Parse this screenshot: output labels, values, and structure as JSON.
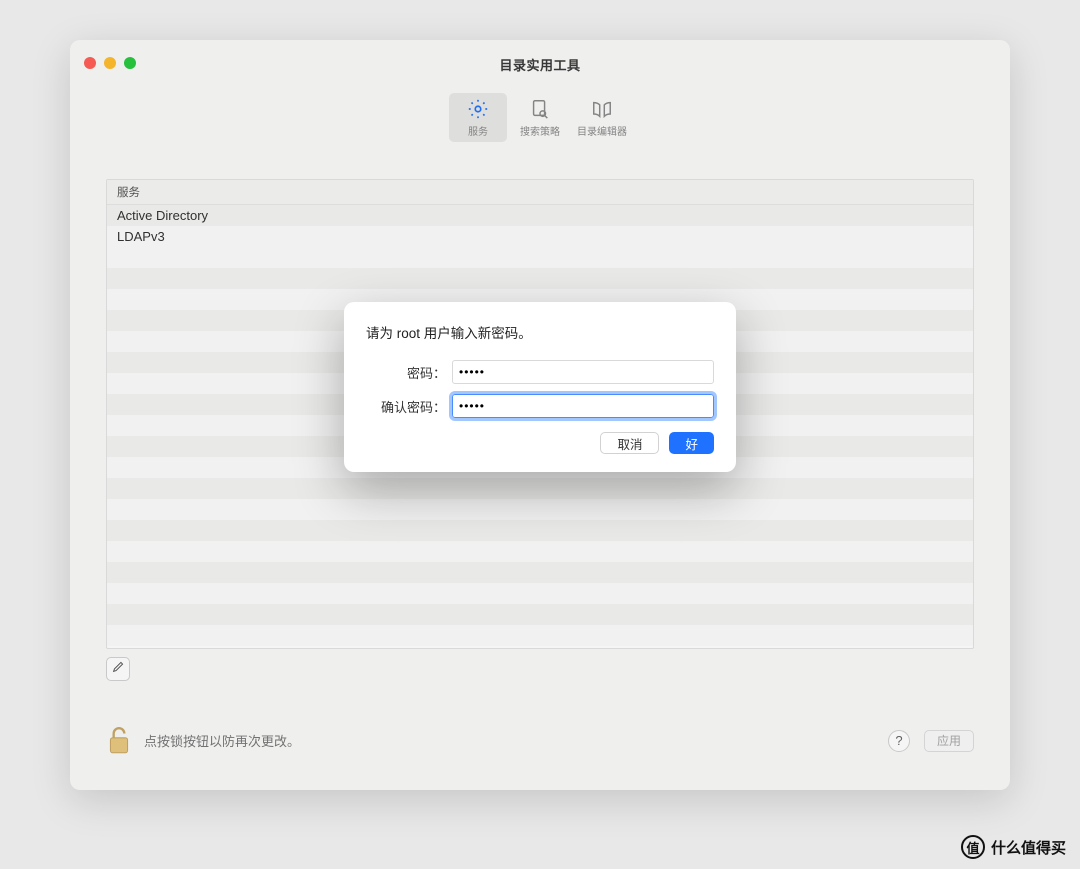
{
  "window": {
    "title": "目录实用工具"
  },
  "toolbar": {
    "services": "服务",
    "search_policy": "搜索策略",
    "dir_editor": "目录编辑器"
  },
  "list": {
    "header": "服务",
    "items": [
      "Active Directory",
      "LDAPv3"
    ]
  },
  "footer": {
    "lock_hint": "点按锁按钮以防再次更改。",
    "help": "?",
    "apply": "应用"
  },
  "modal": {
    "title": "请为 root 用户输入新密码。",
    "password_label": "密码：",
    "confirm_label": "确认密码：",
    "password_value": "•••••",
    "confirm_value": "•••••",
    "cancel": "取消",
    "ok": "好"
  },
  "watermark": {
    "badge": "值",
    "text": "什么值得买"
  }
}
